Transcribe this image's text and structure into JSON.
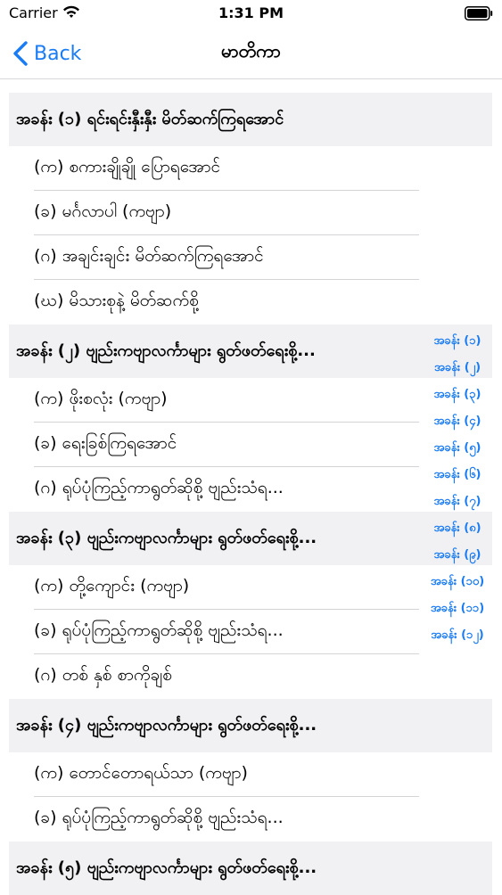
{
  "status_bar": {
    "carrier": "Carrier",
    "time": "1:31 PM"
  },
  "nav": {
    "back_label": "Back",
    "title": "မာတိကာ"
  },
  "sections": [
    {
      "title": "အခန်း (၁) ရင်းရင်းနှီးနှီး မိတ်ဆက်ကြရအောင်",
      "items": [
        "(က) စကားချိုချို ပြောရအောင်",
        "(ခ) မင်္ဂလာပါ (ကဗျာ)",
        "(ဂ) အချင်းချင်း မိတ်ဆက်ကြရအောင်",
        "(ဃ) မိသားစုနဲ့ မိတ်ဆက်စို့"
      ]
    },
    {
      "title": "အခန်း (၂) ဗျည်းကဗျာလင်္ကာများ ရွတ်ဖတ်ရေးစို့...",
      "items": [
        "(က) ဖိုးစလုံး (ကဗျာ)",
        "(ခ) ရေးခြစ်ကြရအောင်",
        "(ဂ) ရုပ်ပုံကြည့်ကာရွတ်ဆိုစို့ ဗျည်းသံရ..."
      ]
    },
    {
      "title": "အခန်း (၃) ဗျည်းကဗျာလင်္ကာများ ရွတ်ဖတ်ရေးစို့...",
      "items": [
        "(က) တို့ကျောင်း (ကဗျာ)",
        "(ခ) ရုပ်ပုံကြည့်ကာရွတ်ဆိုစို့ ဗျည်းသံရ...",
        "(ဂ) တစ် နှစ် စာကိုချစ်"
      ]
    },
    {
      "title": "အခန်း (၄) ဗျည်းကဗျာလင်္ကာများ ရွတ်ဖတ်ရေးစို့...",
      "items": [
        "(က) တောင်တောရယ်သာ (ကဗျာ)",
        "(ခ) ရုပ်ပုံကြည့်ကာရွတ်ဆိုစို့ ဗျည်းသံရ..."
      ]
    },
    {
      "title": "အခန်း (၅) ဗျည်းကဗျာလင်္ကာများ ရွတ်ဖတ်ရေးစို့...",
      "items": []
    }
  ],
  "section_index": [
    "အခန်း (၁)",
    "အခန်း (၂)",
    "အခန်း (၃)",
    "အခန်း (၄)",
    "အခန်း (၅)",
    "အခန်း (၆)",
    "အခန်း (၇)",
    "အခန်း (၈)",
    "အခန်း (၉)",
    "အခန်း (၁၀)",
    "အခန်း (၁၁)",
    "အခန်း (၁၂)"
  ],
  "colors": {
    "accent": "#1a7cf5",
    "section_bg": "#f1f1f3",
    "separator": "#d4d4d8"
  }
}
